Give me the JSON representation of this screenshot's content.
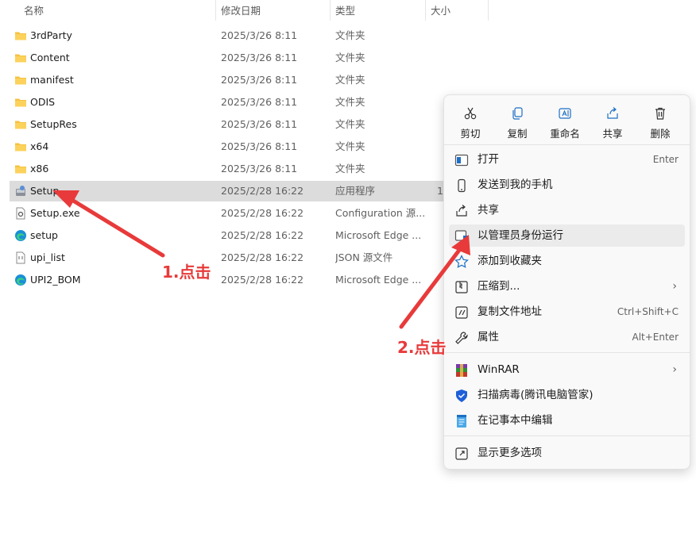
{
  "columns": {
    "name": "名称",
    "date": "修改日期",
    "type": "类型",
    "size": "大小"
  },
  "files": [
    {
      "name": "3rdParty",
      "date": "2025/3/26 8:11",
      "type": "文件夹",
      "size": "",
      "icon": "folder-icon"
    },
    {
      "name": "Content",
      "date": "2025/3/26 8:11",
      "type": "文件夹",
      "size": "",
      "icon": "folder-icon"
    },
    {
      "name": "manifest",
      "date": "2025/3/26 8:11",
      "type": "文件夹",
      "size": "",
      "icon": "folder-icon"
    },
    {
      "name": "ODIS",
      "date": "2025/3/26 8:11",
      "type": "文件夹",
      "size": "",
      "icon": "folder-icon"
    },
    {
      "name": "SetupRes",
      "date": "2025/3/26 8:11",
      "type": "文件夹",
      "size": "",
      "icon": "folder-icon"
    },
    {
      "name": "x64",
      "date": "2025/3/26 8:11",
      "type": "文件夹",
      "size": "",
      "icon": "folder-icon"
    },
    {
      "name": "x86",
      "date": "2025/3/26 8:11",
      "type": "文件夹",
      "size": "",
      "icon": "folder-icon"
    },
    {
      "name": "Setup",
      "date": "2025/2/28 16:22",
      "type": "应用程序",
      "size": "1",
      "icon": "installer-icon",
      "selected": true
    },
    {
      "name": "Setup.exe",
      "date": "2025/2/28 16:22",
      "type": "Configuration 源...",
      "size": "",
      "icon": "config-file-icon"
    },
    {
      "name": "setup",
      "date": "2025/2/28 16:22",
      "type": "Microsoft Edge ...",
      "size": "",
      "icon": "edge-icon"
    },
    {
      "name": "upi_list",
      "date": "2025/2/28 16:22",
      "type": "JSON 源文件",
      "size": "",
      "icon": "json-file-icon"
    },
    {
      "name": "UPI2_BOM",
      "date": "2025/2/28 16:22",
      "type": "Microsoft Edge ...",
      "size": "",
      "icon": "edge-icon"
    }
  ],
  "menu": {
    "quick": [
      {
        "label": "剪切",
        "icon": "cut-icon"
      },
      {
        "label": "复制",
        "icon": "copy-icon"
      },
      {
        "label": "重命名",
        "icon": "rename-icon"
      },
      {
        "label": "共享",
        "icon": "share-icon"
      },
      {
        "label": "删除",
        "icon": "delete-icon"
      }
    ],
    "open": {
      "label": "打开",
      "shortcut": "Enter"
    },
    "send_phone": {
      "label": "发送到我的手机"
    },
    "share": {
      "label": "共享"
    },
    "run_admin": {
      "label": "以管理员身份运行"
    },
    "favorites": {
      "label": "添加到收藏夹"
    },
    "compress": {
      "label": "压缩到..."
    },
    "copy_path": {
      "label": "复制文件地址",
      "shortcut": "Ctrl+Shift+C"
    },
    "properties": {
      "label": "属性",
      "shortcut": "Alt+Enter"
    },
    "winrar": {
      "label": "WinRAR"
    },
    "scan": {
      "label": "扫描病毒(腾讯电脑管家)"
    },
    "notepad": {
      "label": "在记事本中编辑"
    },
    "more": {
      "label": "显示更多选项"
    }
  },
  "annotations": {
    "step1": "1.点击",
    "step2": "2.点击",
    "color": "#e83a3a"
  }
}
